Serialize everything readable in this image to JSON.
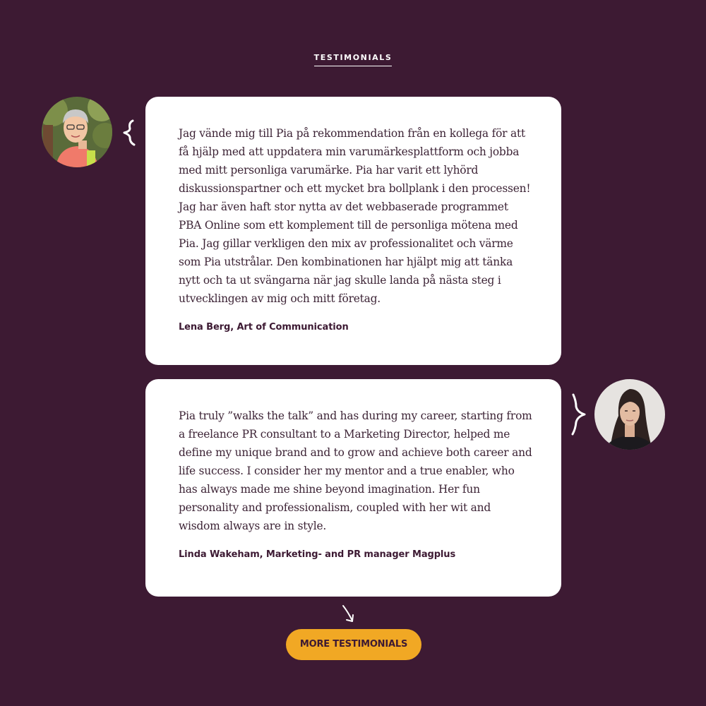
{
  "heading": {
    "label": "TESTIMONIALS"
  },
  "testimonials": [
    {
      "quote": "Jag vände mig till Pia på rekommendation från en kollega för att få hjälp med att uppdatera min varumärkesplattform och jobba med mitt personliga varumärke. Pia har varit ett lyhörd diskussionspartner och ett mycket bra bollplank i den processen! Jag har även haft stor nytta av det webbaserade programmet PBA Online som ett komplement till de personliga mötena med Pia. Jag gillar verkligen den mix av professionalitet och värme som Pia utstrålar. Den kombinationen har hjälpt mig att tänka nytt och ta ut svängarna när jag skulle landa på nästa steg i utvecklingen av mig och mitt företag.",
      "author": "Lena Berg, Art of Communication",
      "avatar_icon": "person-photo"
    },
    {
      "quote": "Pia truly ”walks the talk” and has during my career, starting from a freelance PR consultant to a Marketing Director, helped me define my unique brand and to grow and achieve both career and life success. I consider her my mentor and a true enabler, who has always made me shine beyond imagination. Her fun personality and professionalism, coupled with her wit and wisdom always are in style.",
      "author": "Linda Wakeham, Marketing- and PR manager Magplus",
      "avatar_icon": "person-photo"
    }
  ],
  "cta": {
    "label": "MORE TESTIMONIALS",
    "arrow_icon": "hand-drawn-arrow-down-icon"
  },
  "colors": {
    "background": "#3d1a33",
    "card": "#ffffff",
    "accent": "#f1a824",
    "text": "#3d2436"
  }
}
